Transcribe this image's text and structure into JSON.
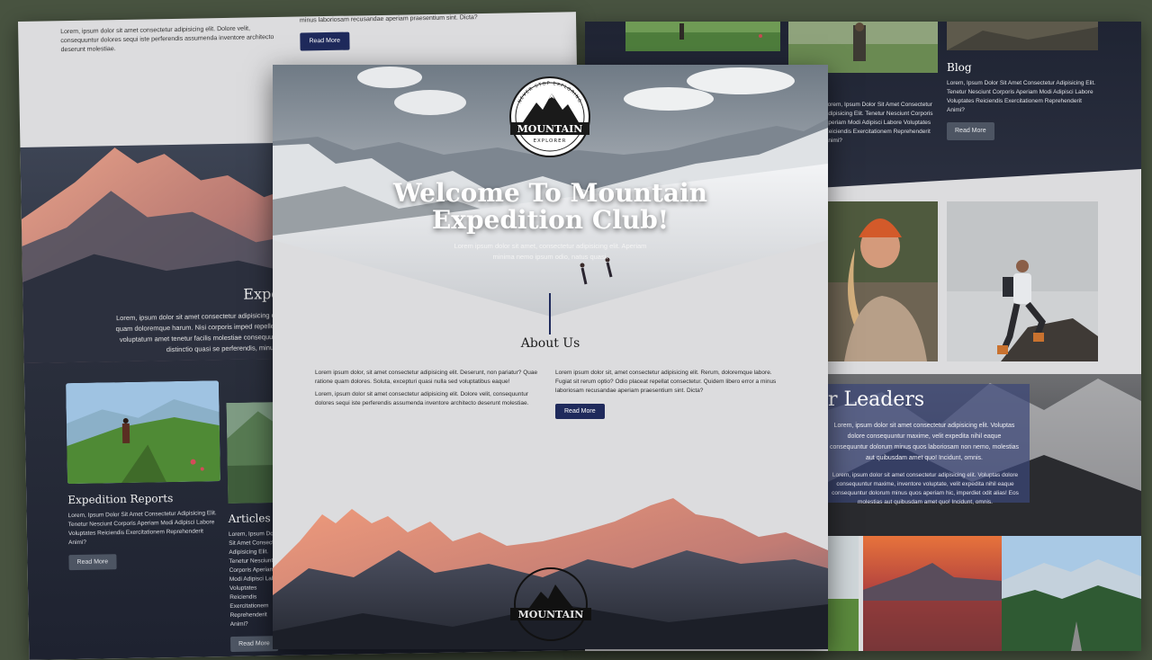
{
  "colors": {
    "background": "#485340",
    "navy": "#1f2a5c",
    "paper": "#dcdcde",
    "dark_section": "#1f2433",
    "leaders_panel": "#3c4678"
  },
  "logo": {
    "top_text": "NEVER STOP EXPLORING",
    "word": "MOUNTAIN",
    "sub": "EXPLORER"
  },
  "left": {
    "top_text": "Lorem, ipsum dolor sit amet consectetur adipisicing elit. Dolore velit, consequuntur dolores sequi iste perferendis assumenda inventore architecto deserunt molestiae.",
    "top_text_2": "minus laboriosam recusandae aperiam praesentium sint. Dicta?",
    "top_button": "Read More",
    "section_title": "Expedition",
    "section_title_partial": "Exped",
    "section_body": "Lorem, ipsum dolor sit amet consectetur adipisicing elit. Dolor corrupti, quam doloremque harum. Nisi corporis imped repellendus accusamus, voluptatum amet tenetur facilis molestiae consequuntur, doloremque distinctio quasi se perferendis, minus",
    "cards": [
      {
        "title": "Expedition Reports",
        "body": "Lorem, Ipsum Dolor Sit Amet Consectetur Adipisicing Elit. Tenetur Nesciunt Corporis Aperiam Modi Adipisci Labore Voluptates Reiciendis Exercitationem Reprehenderit Animi?",
        "button": "Read More"
      },
      {
        "title": "Articles",
        "body": "Lorem, Ipsum Dolor Sit Amet Consectetur Adipisicing Elit. Tenetur Nesciunt Corporis Aperiam Modi Adipisci Labore Voluptates Reiciendis Exercitationem Reprehenderit Animi?",
        "button": "Read More"
      }
    ]
  },
  "right": {
    "blog": {
      "title": "Blog",
      "body": "Lorem, Ipsum Dolor Sit Amet Consectetur Adipisicing Elit. Tenetur Nesciunt Corporis Aperiam Modi Adipisci Labore Voluptates Reiciendis Exercitationem Reprehenderit Animi?",
      "button": "Read More"
    },
    "body_partial": "Lorem, Ipsum Dolor Sit Amet Consectetur Adipisicing Elit. Tenetur Nesciunt Corporis Aperiam Modi Adipisci Labore Voluptates Reiciendis Exercitationem Reprehenderit Animi?",
    "leaders_title": "Our Leaders",
    "leaders_title_visible": "r Leaders",
    "leaders_body": "Lorem, ipsum dolor sit amet consectetur adipisicing elit. Voluptas dolore consequuntur maxime, velit expedita nihil eaque consequuntur dolorum minus quos laboriosam non nemo, molestias aut quibusdam amet quo! Incidunt, omnis.",
    "leaders_body_2": "Lorem, ipsum dolor sit amet consectetur adipisicing elit. Voluptas dolore consequuntur maxime, inventore voluptate, velit expedita nihil eaque consequuntur dolorum minus quos aperiam hic, imperdiet odit alias! Eos molestias aut quibusdam amet quo! Incidunt, omnis."
  },
  "center": {
    "hero_title_line1": "Welcome To Mountain",
    "hero_title_line2": "Expedition Club!",
    "hero_subtitle": "Lorem ipsum dolor sit amet, consectetur adipisicing elit. Aperiam minima nemo ipsum odio, natus quasi.",
    "about_title": "About Us",
    "about_left_1": "Lorem ipsum dolor, sit amet consectetur adipisicing elit. Deserunt, non pariatur? Quae ratione quam dolores. Soluta, excepturi quasi nulla sed voluptatibus eaque!",
    "about_left_2": "Lorem, ipsum dolor sit amet consectetur adipisicing elit. Dolore velit, consequuntur dolores sequi iste perferendis assumenda inventore architecto deserunt molestiae.",
    "about_right_1": "Lorem ipsum dolor sit, amet consectetur adipisicing elit. Rerum, doloremque labore. Fugiat sit rerum optio? Odio placeat repellat consectetur. Quidem libero error a minus laboriosam recusandae aperiam praesentium sint. Dicta?",
    "read_more": "Read More"
  }
}
